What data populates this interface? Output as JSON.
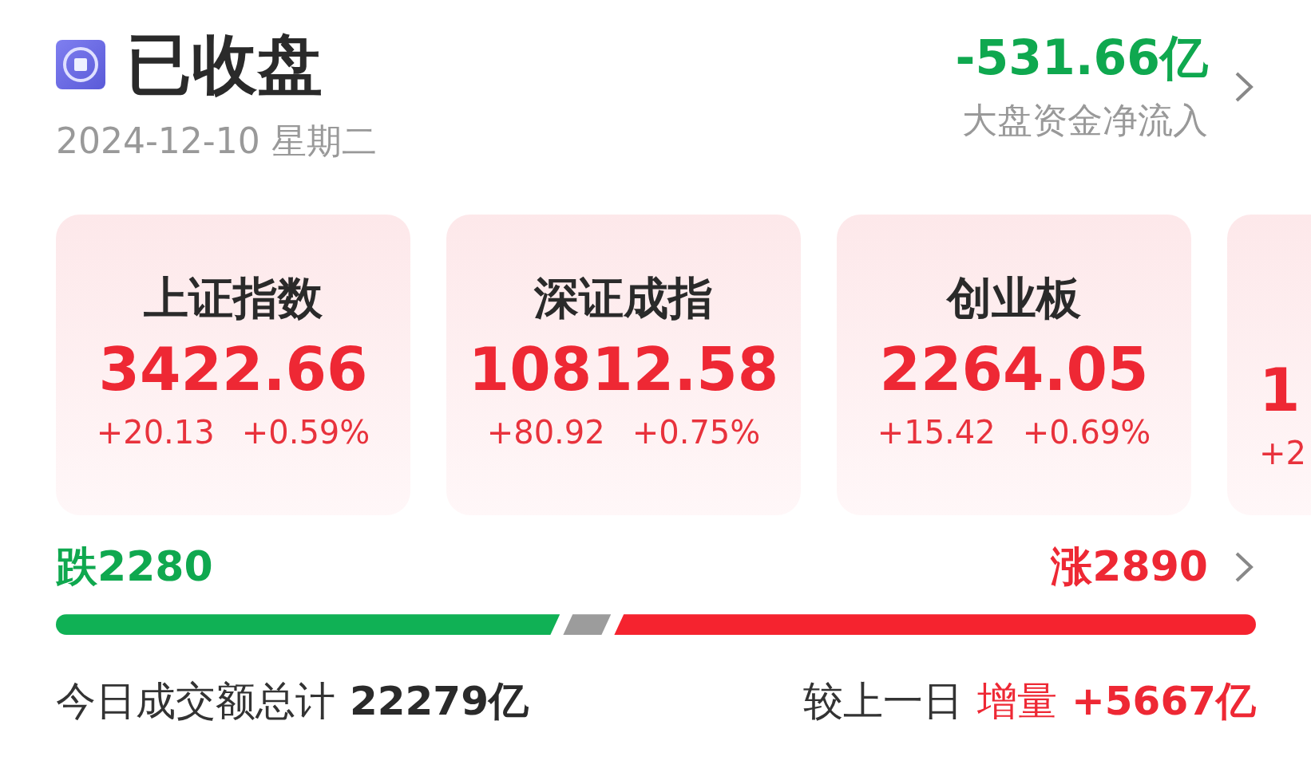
{
  "status": {
    "title": "已收盘",
    "date": "2024-12-10 星期二"
  },
  "net_flow": {
    "value": "-531.66亿",
    "label": "大盘资金净流入"
  },
  "indices": [
    {
      "kind": "full",
      "name": "上证指数",
      "value": "3422.66",
      "change": "+20.13",
      "percent": "+0.59%"
    },
    {
      "kind": "full",
      "name": "深证成指",
      "value": "10812.58",
      "change": "+80.92",
      "percent": "+0.75%"
    },
    {
      "kind": "full",
      "name": "创业板",
      "value": "2264.05",
      "change": "+15.42",
      "percent": "+0.69%"
    },
    {
      "kind": "partial",
      "value": "1",
      "change": "+2"
    }
  ],
  "breadth": {
    "down": "跌2280",
    "up": "涨2890",
    "segments": [
      {
        "kind": "down"
      },
      {
        "kind": "flat"
      },
      {
        "kind": "up"
      }
    ]
  },
  "turnover": {
    "label": "今日成交额总计",
    "value": "22279亿",
    "compare_label": "较上一日",
    "change_label": "增量",
    "change": "+5667亿"
  }
}
